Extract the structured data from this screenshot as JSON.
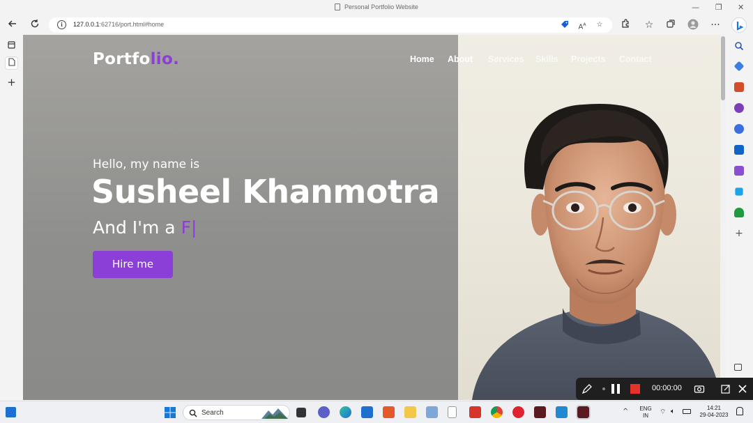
{
  "window": {
    "title": "Personal Portfolio Website",
    "minimize_glyph": "—",
    "maximize_glyph": "❐",
    "close_glyph": "✕"
  },
  "browser": {
    "url_host": "127.0.0.1",
    "url_rest": ":62716/port.html#home"
  },
  "site": {
    "logo_main": "Portfo",
    "logo_accent": "lio.",
    "nav": [
      "Home",
      "About",
      "Services",
      "Skills",
      "Projects",
      "Contact"
    ],
    "hello": "Hello, my name is",
    "name": "Susheel Khanmotra",
    "role_prefix": "And I'm a ",
    "role_typed": "F|",
    "hire_label": "Hire me",
    "accent_color": "#8c3fd6"
  },
  "recorder": {
    "time": "00:00:00"
  },
  "taskbar": {
    "search_label": "Search",
    "lang_line1": "ENG",
    "lang_line2": "IN",
    "clock_time": "14:21",
    "clock_date": "29-04-2023"
  }
}
